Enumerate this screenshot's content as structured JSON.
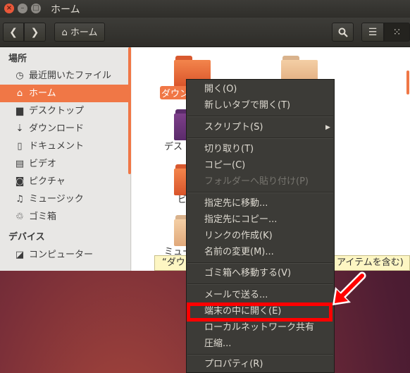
{
  "window": {
    "title": "ホーム",
    "buttons": {
      "close": "×",
      "minimize": "–",
      "maximize": "□"
    }
  },
  "toolbar": {
    "back_icon": "chevron-left-icon",
    "forward_icon": "chevron-right-icon",
    "breadcrumb": "ホーム",
    "search_icon": "search-icon",
    "view_list_icon": "list-icon",
    "view_grid_icon": "grid-icon"
  },
  "sidebar": {
    "places_header": "場所",
    "places": [
      {
        "label": "最近開いたファイル",
        "icon": "clock-icon",
        "glyph": "◷"
      },
      {
        "label": "ホーム",
        "icon": "home-icon",
        "glyph": "⌂"
      },
      {
        "label": "デスクトップ",
        "icon": "folder-icon",
        "glyph": "▆"
      },
      {
        "label": "ダウンロード",
        "icon": "download-icon",
        "glyph": "⇣"
      },
      {
        "label": "ドキュメント",
        "icon": "document-icon",
        "glyph": "▯"
      },
      {
        "label": "ビデオ",
        "icon": "film-icon",
        "glyph": "▤"
      },
      {
        "label": "ピクチャ",
        "icon": "camera-icon",
        "glyph": "◙"
      },
      {
        "label": "ミュージック",
        "icon": "music-icon",
        "glyph": "♫"
      },
      {
        "label": "ゴミ箱",
        "icon": "trash-icon",
        "glyph": "♲"
      }
    ],
    "devices_header": "デバイス",
    "devices": [
      {
        "label": "コンピューター",
        "icon": "computer-icon",
        "glyph": "◪"
      }
    ]
  },
  "files": [
    {
      "label": "ダウン",
      "selected": true
    },
    {
      "label": ""
    },
    {
      "label": "デス"
    },
    {
      "label": "ビ"
    },
    {
      "label": "ミュー"
    }
  ],
  "statusbar": {
    "left": "“ダウ",
    "right": "アイテムを含む)"
  },
  "context_menu": {
    "items": [
      {
        "label": "開く(O)"
      },
      {
        "label": "新しいタブで開く(T)"
      },
      {
        "label": "スクリプト(S)",
        "submenu": true
      },
      {
        "label": "切り取り(T)"
      },
      {
        "label": "コピー(C)"
      },
      {
        "label": "フォルダーへ貼り付け(P)",
        "disabled": true
      },
      {
        "label": "指定先に移動..."
      },
      {
        "label": "指定先にコピー..."
      },
      {
        "label": "リンクの作成(K)"
      },
      {
        "label": "名前の変更(M)..."
      },
      {
        "label": "ゴミ箱へ移動する(V)"
      },
      {
        "label": "メールで送る..."
      },
      {
        "label": "端末の中に開く(E)",
        "highlighted": true
      },
      {
        "label": "ローカルネットワーク共有"
      },
      {
        "label": "圧縮..."
      },
      {
        "label": "プロパティ(R)"
      }
    ]
  },
  "colors": {
    "accent": "#f07746",
    "menu_bg": "#3c3b37",
    "annotation_red": "#ff0000"
  }
}
